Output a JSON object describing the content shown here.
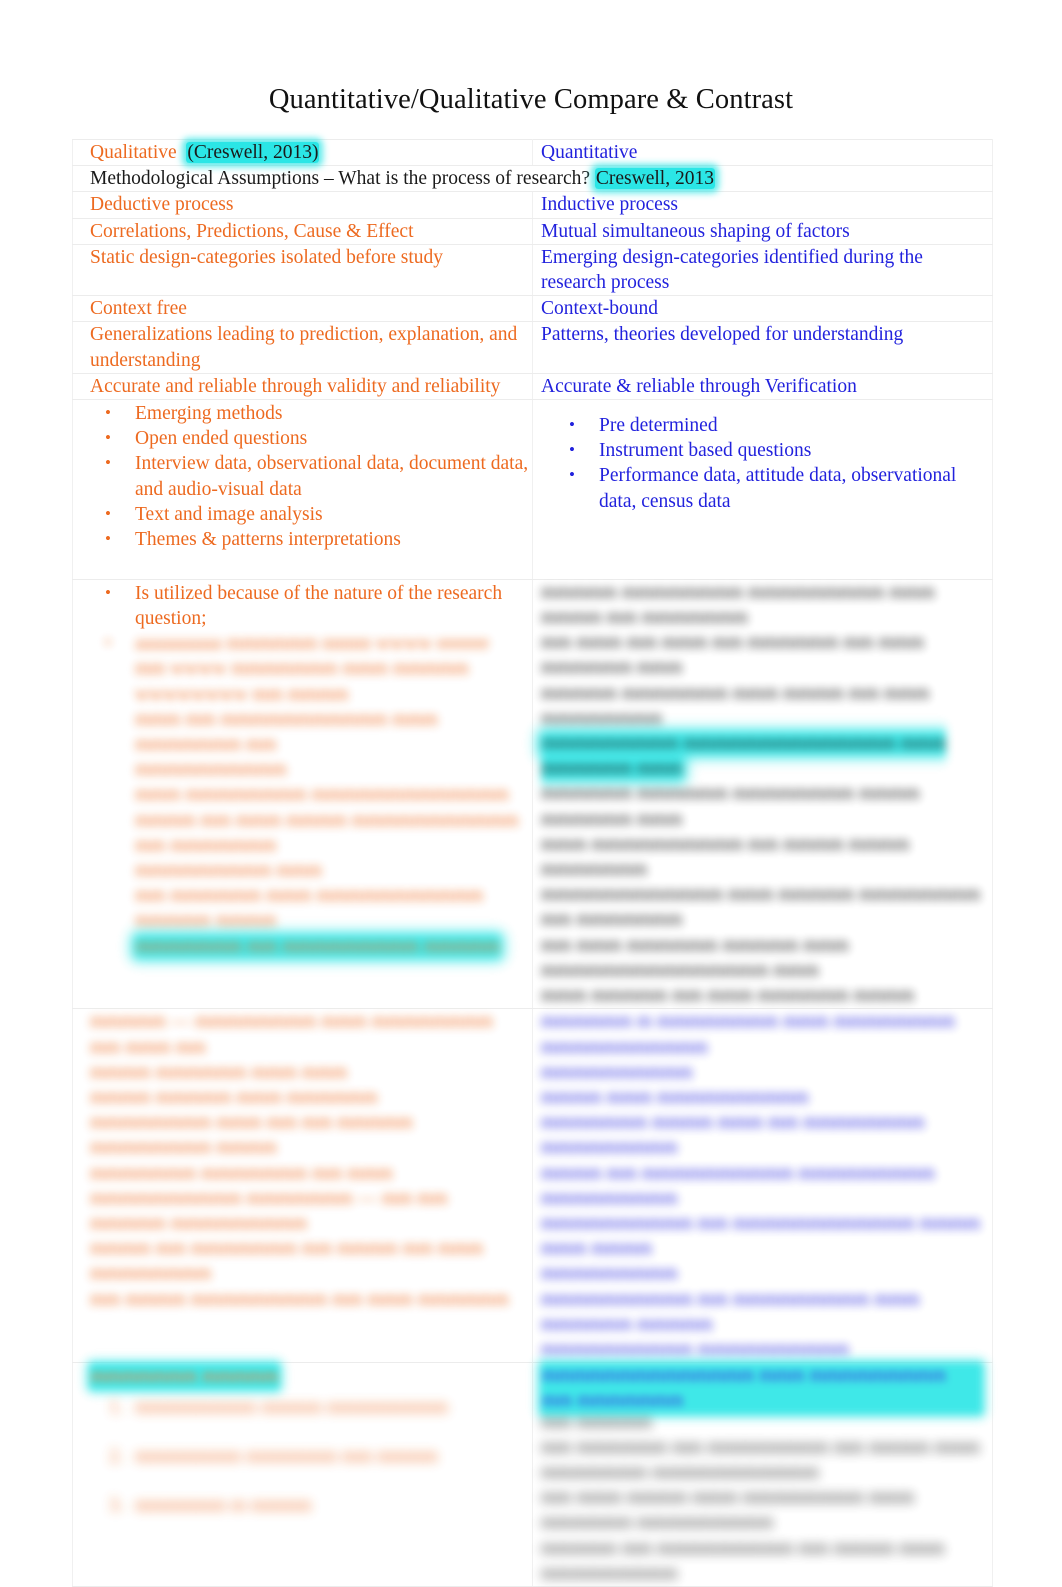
{
  "document": {
    "title": "Quantitative/Qualitative Compare & Contrast"
  },
  "colors": {
    "qualitative_text": "#ED6A20",
    "quantitative_text": "#2222DD",
    "highlight": "#2BE6E6",
    "body_text": "#1a1a1a",
    "table_border": "#f0f0f0",
    "page_background": "#ffffff"
  },
  "table": {
    "headers": {
      "left_label": "Qualitative",
      "left_citation": "(Creswell, 2013)",
      "right_label": "Quantitative"
    },
    "assumption_line": {
      "text": "Methodological Assumptions – What is the process of research?",
      "citation": "Creswell, 2013"
    },
    "rows": [
      {
        "left": "Deductive process",
        "right": "Inductive process"
      },
      {
        "left": "Correlations, Predictions, Cause & Effect",
        "right": "Mutual simultaneous shaping of factors"
      },
      {
        "left": "Static design-categories isolated before study",
        "right": "Emerging design-categories identified during the research process"
      },
      {
        "left": "Context free",
        "right": "Context-bound"
      },
      {
        "left": "Generalizations leading to prediction, explanation, and understanding",
        "right": "Patterns, theories developed for understanding"
      },
      {
        "left": "Accurate and reliable through validity and reliability",
        "right": "Accurate & reliable through Verification"
      }
    ],
    "bullets": {
      "left": [
        "Emerging methods",
        "Open ended questions",
        "Interview data, observational data, document data, and audio-visual data",
        "Text and image analysis",
        "Themes & patterns interpretations",
        "Is utilized because of the nature of the research question;"
      ],
      "right": [
        "Pre determined",
        "Instrument based questions",
        "Performance data, attitude data, observational data, census data"
      ]
    },
    "redacted": {
      "note": "Lower portion of the table is visually blurred and illegible in the source screenshot.",
      "left_block_1": [
        "aaaaaaaaaa mmmmmm nnnnn wwww eeeeee",
        "mm wwww mmmmmmm mmm mmmmm wwwwwwww mm mmmm",
        "mmm mm mmmmmmmmmmm mmm mmmmmmm mm",
        "mmmmmmmmmm",
        "mmm mmmmmmmm mmmmmmmmmmmmm",
        "mmmm mm mmm mmmm mmmmmmmmmmm mm mmmmmmm",
        "mmmmmmmmm mmm",
        "mm mmmmmm mmm mmmmmmmmmmm mmmmm mmmm",
        "mmmmmmm mm mmmmmmmmm mmmmm"
      ],
      "left_block_2": [
        "mmmmm — mmmmmmmm mmm mmmmmmmm mm mmm mm",
        "mmmm mmmmmm mmm mmm",
        "mmmm mmmmm mmm mmmmmm",
        "mmmmmmmm mmm mm mm mmmmm mmmmmmmm mmmm",
        "mmmmmmm mmmmmmm mm mmm",
        "mmmmmmmmmm mmmmmmm — mm mm mmmmm mmmmmmmmm",
        "mmmm mm mmmmmmm mm mmmm mm mmm mmmmmmmm",
        "mm mmmm mmmmmmmmm mm mmm mmmmmm"
      ],
      "left_block_3": [
        "mmmmmmm mmmmm",
        "mmmmmmmm mmmm mmmmmmmm",
        "mmmmmmm mmmmmm mm mmmm",
        "mmmmmm m mmmm"
      ],
      "right_block_1": [
        "mmmmm mmmmmmmm mmmmmmmmm mmm mmmm mm mmmmmmm",
        "mm mmm mm mmm mm mmmmmm mm mmm mmmmmm mmm",
        "mmmmm mmmmmmm mmm mmmm mm mmm mmmmmmmm",
        "mmmmmmmmm mmmmmmmmmmmmmm mmm mmmmmm mmm",
        "mmmmmm mmmmmm mmmmmmmm mmmm mmmmmm mmm",
        "mmm mmmmmmmmmm mm mmmm mmmm mmmmmmm",
        "mmmmmmmmmmmm mmm mmmmm mmmmmmmm mm mmmmmmm",
        "mm mmm mmmmmm mmmmm mmm mmmmmmmmmmmmmmm mmm",
        "mmm mmmmm mm mmm mmmmmm mmmm"
      ],
      "right_block_2": [
        "mmmmmm m mmmmmmmm mmm mmmmmmmm mmmmmmmmmmm",
        "mmmmmmmmmm",
        "mmmm mmm mmmmmmmmmm",
        "mmmmmmm mmmm mmm mm mmmmmmmm mmmmmmmmm",
        "mmmm mm mmmmmmmmmm mmmmmmmmm mmmmmmmmm",
        "mmmmmmmmmm mm mmmmmmmmmmmm mmmm mmm mmmm",
        "mmmmmmmmm",
        "mmmmmmmmmm mm mmmmmmmmm mmm mmmmmm mmmmm",
        "mmmmmmmmmm mmmmmmmmmm"
      ],
      "right_block_3": [
        "mmmmmmmmmmmmmm mmm mmmmmmmmm mm mmmmmmm",
        "mm mmmmm",
        "mm mmmmmm mm mmmmmmmm mm mmmm mmm",
        "mmmmmmm mmmmmmmmmmm",
        "mm mmm mmmm mmm mmmmmmmm mmm",
        "mmmmmm mmmmmmmmm",
        "mmmmm mm mmmmmmmmm mm mmmm mmm mmmmmmmmm"
      ]
    }
  }
}
